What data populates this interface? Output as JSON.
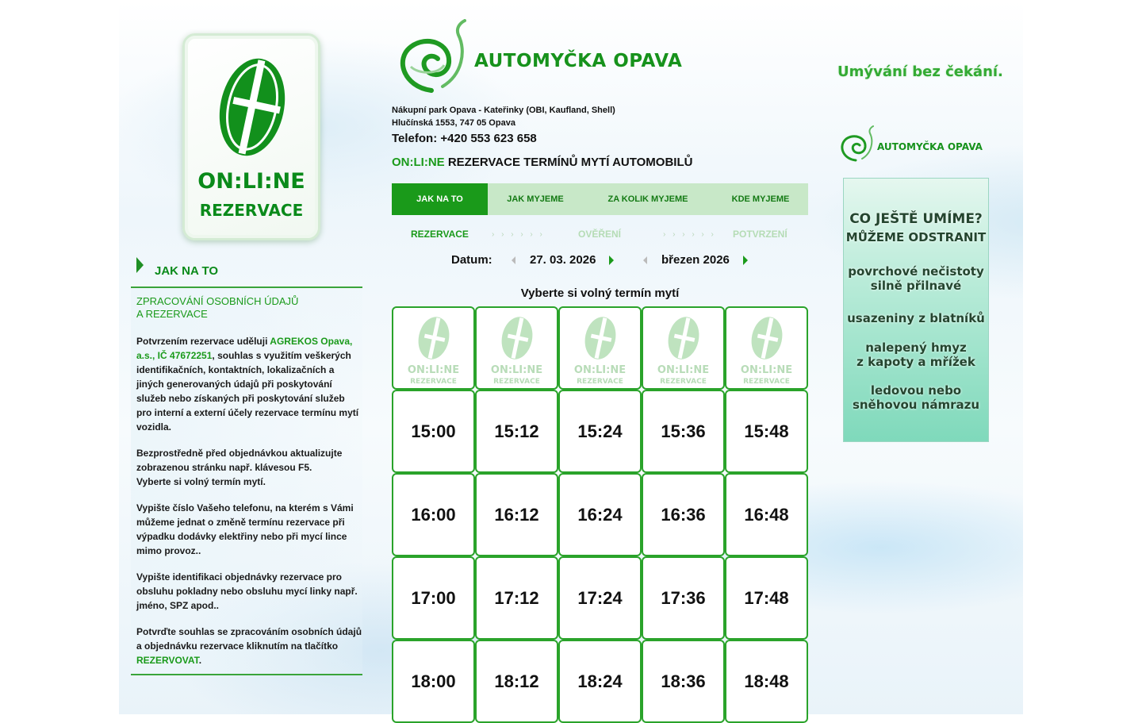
{
  "header": {
    "brand_name": "AUTOMYČKA OPAVA",
    "tagline": "Umývání bez čekání.",
    "address_line1": "Nákupní park Opava - Kateřinky (OBI, Kaufland, Shell)",
    "address_line2": "Hlučínská 1553, 747 05 Opava",
    "phone": "Telefon: +420 553 623 658",
    "title_prefix": "ON:LI:NE",
    "title_rest": " REZERVACE TERMÍNŮ MYTÍ AUTOMOBILŮ"
  },
  "badge": {
    "line1": "ON:LI:NE",
    "line2": "REZERVACE"
  },
  "nav": {
    "items": [
      {
        "label": "JAK NA TO",
        "active": true
      },
      {
        "label": "JAK MYJEME"
      },
      {
        "label": "ZA KOLIK MYJEME"
      },
      {
        "label": "KDE MYJEME"
      }
    ]
  },
  "steps": {
    "step1": "REZERVACE",
    "step2": "OVĚŘENÍ",
    "step3": "POTVRZENÍ",
    "dots": "› › › › › ›"
  },
  "date_selector": {
    "label": "Datum:",
    "date": "27. 03. 2026",
    "month": "březen 2026"
  },
  "grid": {
    "caption": "Vyberte si volný termín mytí",
    "logo_line1": "ON:LI:NE",
    "logo_line2": "REZERVACE",
    "rows": [
      [
        "15:00",
        "15:12",
        "15:24",
        "15:36",
        "15:48"
      ],
      [
        "16:00",
        "16:12",
        "16:24",
        "16:36",
        "16:48"
      ],
      [
        "17:00",
        "17:12",
        "17:24",
        "17:36",
        "17:48"
      ],
      [
        "18:00",
        "18:12",
        "18:24",
        "18:36",
        "18:48"
      ]
    ]
  },
  "sidebar": {
    "heading": "JAK NA TO",
    "title_line1": "ZPRACOVÁNÍ OSOBNÍCH ÚDAJŮ",
    "title_line2": "A REZERVACE",
    "p1_a": "Potvrzením rezervace uděluji ",
    "p1_company": "AGREKOS Opava, a.s., IČ 47672251",
    "p1_b": ", souhlas s využitím veškerých identifikačních, kontaktních, lokalizačních a jiných generovaných údajů při poskytování služeb nebo získaných při poskytování služeb pro interní a externí účely rezervace termínu mytí vozidla.",
    "p2": "Bezprostředně před objednávkou aktualizujte zobrazenou stránku např. klávesou F5.",
    "p2b": "Vyberte si volný termín mytí.",
    "p3": "Vypište číslo Vašeho telefonu, na kterém s Vámi můžeme jednat o změně termínu rezervace při výpadku dodávky elektřiny nebo při mycí lince mimo provoz..",
    "p4": "Vypište identifikaci objednávky rezervace pro obsluhu pokladny nebo obsluhu mycí linky např. jméno, SPZ apod..",
    "p5_a": "Potvrďte souhlas se zpracováním osobních údajů a objednávku rezervace kliknutím na tlačítko ",
    "p5_link": "REZERVOVAT",
    "p5_b": "."
  },
  "right": {
    "small_brand": "AUTOMYČKA OPAVA",
    "promo": {
      "heading1": "CO JEŠTĚ UMÍME?",
      "heading2": "MŮŽEME ODSTRANIT",
      "item1a": "povrchové nečistoty",
      "item1b": "silně přilnavé",
      "item2": "usazeniny z blatníků",
      "item3a": "nalepený hmyz",
      "item3b": "z kapoty a mřížek",
      "item4a": "ledovou nebo",
      "item4b": "sněhovou námrazu"
    }
  },
  "colors": {
    "accent": "#1a9a1a",
    "nav_bg": "#c8e8c8",
    "promo_bg": "#7fd9bb"
  }
}
